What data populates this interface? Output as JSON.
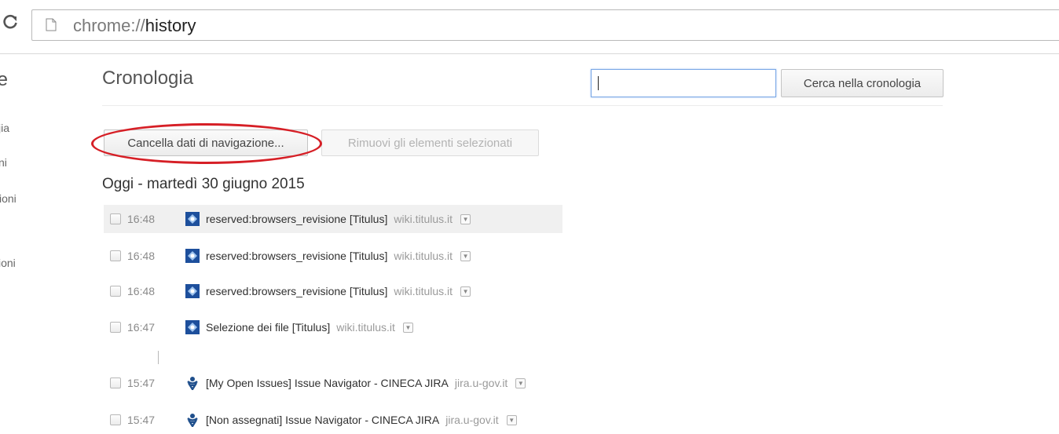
{
  "browser": {
    "url_scheme": "chrome://",
    "url_host": "history"
  },
  "sidebar": {
    "title_fragment": "ıe",
    "items": [
      "jia",
      "ni",
      "cioni",
      "ioni"
    ]
  },
  "history": {
    "title": "Cronologia",
    "search_value": "",
    "search_button": "Cerca nella cronologia",
    "clear_button": "Cancella dati di navigazione...",
    "remove_button": "Rimuovi gli elementi selezionati",
    "day_header": "Oggi - martedì 30 giugno 2015",
    "entries": [
      {
        "time": "16:48",
        "title": "reserved:browsers_revisione [Titulus]",
        "domain": "wiki.titulus.it",
        "favicon": "titulus-icon"
      },
      {
        "time": "16:48",
        "title": "reserved:browsers_revisione [Titulus]",
        "domain": "wiki.titulus.it",
        "favicon": "titulus-icon"
      },
      {
        "time": "16:48",
        "title": "reserved:browsers_revisione [Titulus]",
        "domain": "wiki.titulus.it",
        "favicon": "titulus-icon"
      },
      {
        "time": "16:47",
        "title": "Selezione dei file [Titulus]",
        "domain": "wiki.titulus.it",
        "favicon": "titulus-icon"
      },
      {
        "time": "15:47",
        "title": "[My Open Issues] Issue Navigator - CINECA JIRA",
        "domain": "jira.u-gov.it",
        "favicon": "jira-icon"
      },
      {
        "time": "15:47",
        "title": "[Non assegnati] Issue Navigator - CINECA JIRA",
        "domain": "jira.u-gov.it",
        "favicon": "jira-icon"
      }
    ]
  },
  "colors": {
    "highlight": "#d61f26",
    "titulus_favicon": "#1d4f9c",
    "jira_favicon": "#1f4f8c"
  }
}
